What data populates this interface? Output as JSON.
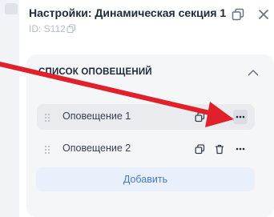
{
  "panel": {
    "title": "Настройки: Динамическая секция 1",
    "id_label": "ID: S112"
  },
  "icons": {
    "copy_id": "copy-icon",
    "popout": "popout-window-icon",
    "close": "close-icon",
    "collapse": "chevron-up-icon",
    "drag": "drag-handle-icon",
    "duplicate": "copy-icon",
    "delete": "trash-icon",
    "more": "more-horizontal-icon"
  },
  "section": {
    "title": "СПИСОК ОПОВЕЩЕНИЙ",
    "items": [
      {
        "label": "Оповещение 1",
        "active": true
      },
      {
        "label": "Оповещение 2",
        "active": false
      }
    ],
    "add_label": "Добавить"
  },
  "colors": {
    "annotation_arrow": "#e0202a",
    "add_button_text": "#4b77c4",
    "add_button_bg": "#e8f0fb"
  }
}
